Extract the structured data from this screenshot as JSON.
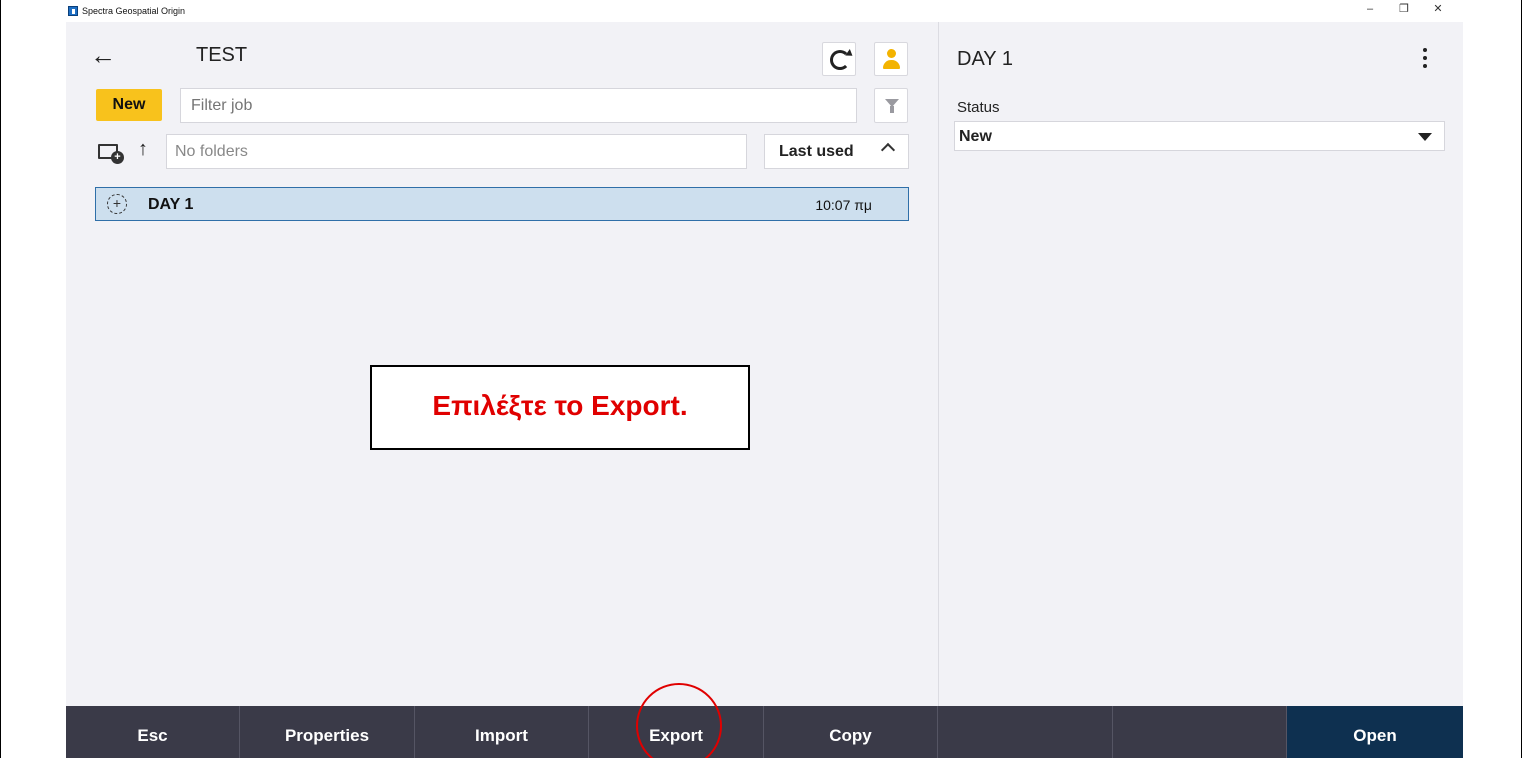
{
  "window": {
    "title": "Spectra Geospatial Origin",
    "minimize": "–",
    "restore": "❐",
    "close": "✕"
  },
  "header": {
    "back_icon": "←",
    "job_title": "TEST"
  },
  "toolbar": {
    "new_label": "New",
    "filter_placeholder": "Filter job"
  },
  "folders": {
    "up_icon": "↑",
    "placeholder": "No folders",
    "sort_label": "Last used"
  },
  "jobs": [
    {
      "name": "DAY 1",
      "time": "10:07 πμ",
      "icon": "+"
    }
  ],
  "callout": {
    "text": "Επιλέξτε το Export."
  },
  "detail": {
    "title": "DAY 1",
    "status_label": "Status",
    "status_value": "New"
  },
  "bottom_bar": {
    "esc": "Esc",
    "properties": "Properties",
    "import": "Import",
    "export": "Export",
    "copy": "Copy",
    "open": "Open"
  },
  "colors": {
    "accent": "#f8c21c",
    "selection": "#cddfee",
    "bar": "#3a3a48",
    "open": "#0e3050",
    "highlight": "#e00000"
  }
}
